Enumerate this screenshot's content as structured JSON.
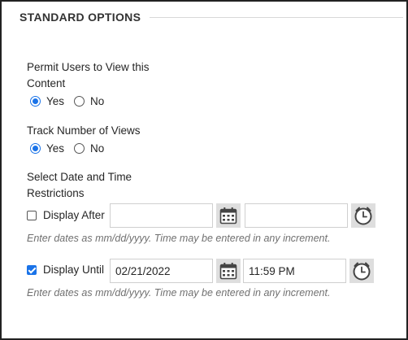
{
  "section": {
    "title": "STANDARD OPTIONS"
  },
  "permit_view": {
    "label": "Permit Users to View this Content",
    "label_line1": "Permit Users to View this",
    "label_line2": "Content",
    "options": [
      "Yes",
      "No"
    ],
    "selected": "Yes"
  },
  "track_views": {
    "label": "Track Number of Views",
    "options": [
      "Yes",
      "No"
    ],
    "selected": "Yes"
  },
  "date_restrictions": {
    "label": "Select Date and Time Restrictions",
    "label_line1": "Select Date and Time",
    "label_line2": "Restrictions",
    "display_after": {
      "label": "Display After",
      "checked": false,
      "date_value": "",
      "time_value": ""
    },
    "display_until": {
      "label": "Display Until",
      "checked": true,
      "date_value": "02/21/2022",
      "time_value": "11:59 PM"
    },
    "hint": "Enter dates as mm/dd/yyyy. Time may be entered in any increment."
  },
  "icons": {
    "calendar": "calendar-icon",
    "clock": "clock-icon"
  },
  "colors": {
    "accent": "#1a73e8",
    "icon_button_bg": "#dedede",
    "hint_text": "#707070"
  }
}
